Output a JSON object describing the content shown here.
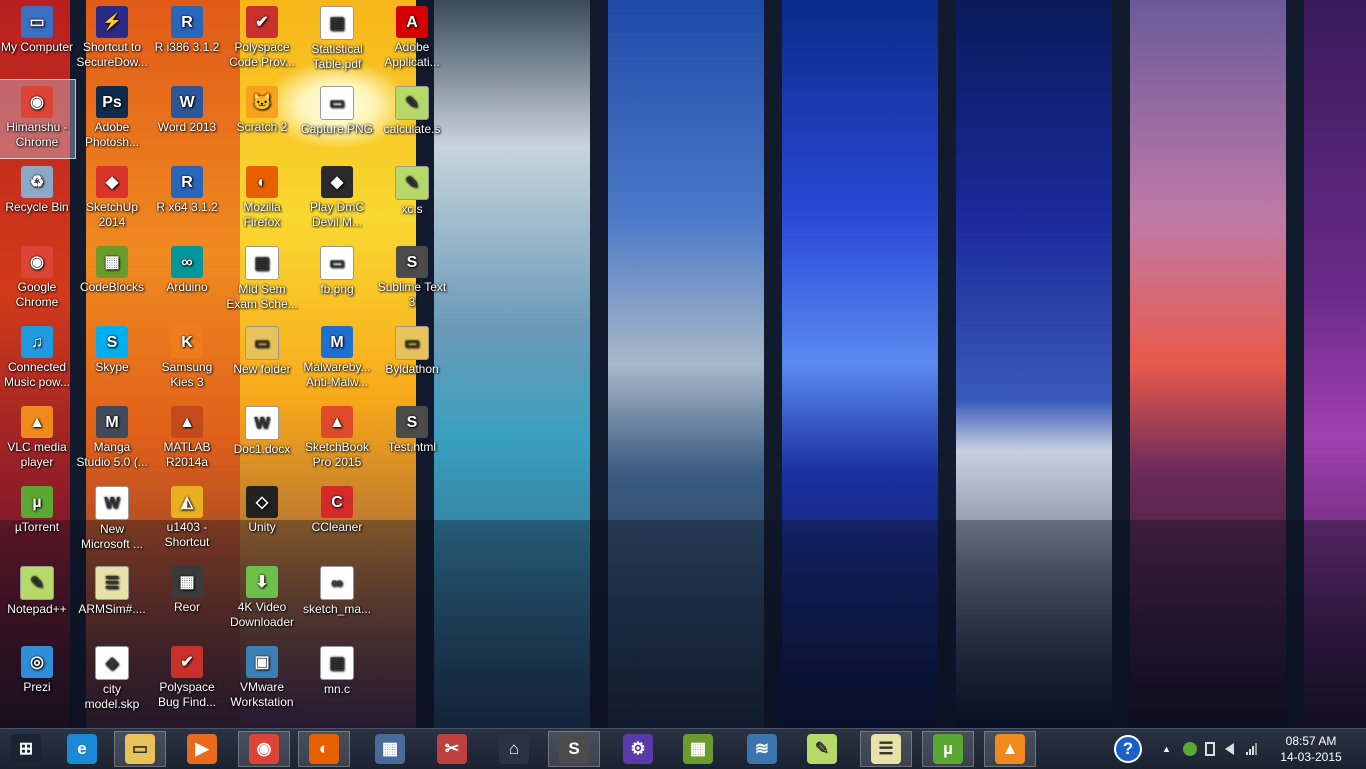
{
  "desktop": {
    "icons": [
      {
        "label": "My Computer",
        "icon": "computer-icon",
        "color": "#3a6fc4",
        "glyph": "▭"
      },
      {
        "label": "Himanshu - Chrome",
        "icon": "chrome-icon",
        "color": "#db4437",
        "glyph": "◉",
        "selected": true
      },
      {
        "label": "Recycle Bin",
        "icon": "recycle-bin-icon",
        "color": "#8aa9c6",
        "glyph": "♻"
      },
      {
        "label": "Google Chrome",
        "icon": "chrome-icon",
        "color": "#db4437",
        "glyph": "◉"
      },
      {
        "label": "Connected Music pow...",
        "icon": "music-icon",
        "color": "#1e9be0",
        "glyph": "♫"
      },
      {
        "label": "VLC media player",
        "icon": "vlc-icon",
        "color": "#f08a1c",
        "glyph": "▲"
      },
      {
        "label": "µTorrent",
        "icon": "utorrent-icon",
        "color": "#5aa832",
        "glyph": "µ"
      },
      {
        "label": "Notepad++",
        "icon": "notepad-plus-icon",
        "color": "#b7d96a",
        "glyph": "✎"
      },
      {
        "label": "Prezi",
        "icon": "prezi-icon",
        "color": "#2f8ed8",
        "glyph": "◎"
      },
      {
        "label": "Shortcut to SecureDow...",
        "icon": "lightning-icon",
        "color": "#2a2a8a",
        "glyph": "⚡"
      },
      {
        "label": "Adobe Photosh...",
        "icon": "photoshop-icon",
        "color": "#0f2a4a",
        "glyph": "Ps"
      },
      {
        "label": "SketchUp 2014",
        "icon": "sketchup-icon",
        "color": "#d9342b",
        "glyph": "◆"
      },
      {
        "label": "CodeBlocks",
        "icon": "codeblocks-icon",
        "color": "#6b9b2c",
        "glyph": "▦"
      },
      {
        "label": "Skype",
        "icon": "skype-icon",
        "color": "#00aff0",
        "glyph": "S"
      },
      {
        "label": "Manga Studio 5.0 (...",
        "icon": "manga-studio-icon",
        "color": "#404a5a",
        "glyph": "M"
      },
      {
        "label": "New Microsoft ...",
        "icon": "word-doc-icon",
        "color": "#ffffff",
        "glyph": "W"
      },
      {
        "label": "ARMSim#....",
        "icon": "armsim-icon",
        "color": "#e8e2a8",
        "glyph": "☰"
      },
      {
        "label": "city model.skp",
        "icon": "sketchup-file-icon",
        "color": "#ffffff",
        "glyph": "◆"
      },
      {
        "label": "R i386 3.1.2",
        "icon": "r-icon",
        "color": "#2766b8",
        "glyph": "R"
      },
      {
        "label": "Word 2013",
        "icon": "word-icon",
        "color": "#2b579a",
        "glyph": "W"
      },
      {
        "label": "R x64 3.1.2",
        "icon": "r-icon",
        "color": "#2766b8",
        "glyph": "R"
      },
      {
        "label": "Arduino",
        "icon": "arduino-icon",
        "color": "#00979c",
        "glyph": "∞"
      },
      {
        "label": "Samsung Kies 3",
        "icon": "samsung-kies-icon",
        "color": "#f07b1d",
        "glyph": "K"
      },
      {
        "label": "MATLAB R2014a",
        "icon": "matlab-icon",
        "color": "#c44a1e",
        "glyph": "▲"
      },
      {
        "label": "u1403 - Shortcut",
        "icon": "u1403-icon",
        "color": "#e8b020",
        "glyph": "◭"
      },
      {
        "label": "Reor",
        "icon": "reor-icon",
        "color": "#3a3a3a",
        "glyph": "▦"
      },
      {
        "label": "Polyspace Bug Find...",
        "icon": "polyspace-icon",
        "color": "#c9302c",
        "glyph": "✔"
      },
      {
        "label": "Polyspace Code Prov...",
        "icon": "polyspace-icon",
        "color": "#c9302c",
        "glyph": "✔"
      },
      {
        "label": "Scratch 2",
        "icon": "scratch-icon",
        "color": "#f7a21a",
        "glyph": "🐱"
      },
      {
        "label": "Mozilla Firefox",
        "icon": "firefox-icon",
        "color": "#e66000",
        "glyph": "◐"
      },
      {
        "label": "Mid Sem Exam Sche...",
        "icon": "pdf-file-icon",
        "color": "#ffffff",
        "glyph": "▤"
      },
      {
        "label": "New folder",
        "icon": "folder-icon",
        "color": "#e8c25a",
        "glyph": "▭"
      },
      {
        "label": "Doc1.docx",
        "icon": "word-doc-icon",
        "color": "#ffffff",
        "glyph": "W"
      },
      {
        "label": "Unity",
        "icon": "unity-icon",
        "color": "#222222",
        "glyph": "◇"
      },
      {
        "label": "4K Video Downloader",
        "icon": "video-downloader-icon",
        "color": "#6cbf4a",
        "glyph": "⬇"
      },
      {
        "label": "VMware Workstation",
        "icon": "vmware-icon",
        "color": "#3c7fb5",
        "glyph": "▣"
      },
      {
        "label": "Statistical Table.pdf",
        "icon": "pdf-file-icon",
        "color": "#ffffff",
        "glyph": "▤"
      },
      {
        "label": "Capture.PNG",
        "icon": "image-file-icon",
        "color": "#ffffff",
        "glyph": "▭"
      },
      {
        "label": "Play DmC Devil M...",
        "icon": "game-icon",
        "color": "#2a2a2a",
        "glyph": "◆"
      },
      {
        "label": "fb.png",
        "icon": "image-file-icon",
        "color": "#ffffff",
        "glyph": "▭"
      },
      {
        "label": "Malwareby... Anti-Malw...",
        "icon": "malwarebytes-icon",
        "color": "#1f6fd1",
        "glyph": "M"
      },
      {
        "label": "SketchBook Pro 2015",
        "icon": "sketchbook-icon",
        "color": "#e04a2c",
        "glyph": "▲"
      },
      {
        "label": "CCleaner",
        "icon": "ccleaner-icon",
        "color": "#d42a2a",
        "glyph": "C"
      },
      {
        "label": "sketch_ma...",
        "icon": "arduino-file-icon",
        "color": "#ffffff",
        "glyph": "∞"
      },
      {
        "label": "mn.c",
        "icon": "c-file-icon",
        "color": "#ffffff",
        "glyph": "▤"
      },
      {
        "label": "Adobe Applicati...",
        "icon": "adobe-icon",
        "color": "#d40000",
        "glyph": "A"
      },
      {
        "label": "calculate.s",
        "icon": "notepad-plus-file-icon",
        "color": "#b7d96a",
        "glyph": "✎"
      },
      {
        "label": "xc.s",
        "icon": "notepad-plus-file-icon",
        "color": "#b7d96a",
        "glyph": "✎"
      },
      {
        "label": "Sublime Text 3",
        "icon": "sublime-icon",
        "color": "#4b4b4b",
        "glyph": "S"
      },
      {
        "label": "Byldathon",
        "icon": "folder-icon",
        "color": "#e8c25a",
        "glyph": "▭"
      },
      {
        "label": "Test.html",
        "icon": "sublime-file-icon",
        "color": "#4b4b4b",
        "glyph": "S"
      }
    ]
  },
  "taskbar": {
    "buttons": [
      {
        "name": "start-button",
        "icon": "windows-logo-icon",
        "color": "#1a2433",
        "glyph": "⊞"
      },
      {
        "name": "ie-button",
        "icon": "internet-explorer-icon",
        "color": "#1a8ad6",
        "glyph": "e"
      },
      {
        "name": "file-explorer-button",
        "icon": "folder-icon",
        "color": "#e8c25a",
        "glyph": "▭",
        "active": true
      },
      {
        "name": "media-player-button",
        "icon": "media-player-icon",
        "color": "#e86a1c",
        "glyph": "▶"
      },
      {
        "name": "chrome-button",
        "icon": "chrome-icon",
        "color": "#db4437",
        "glyph": "◉",
        "active": true
      },
      {
        "name": "firefox-button",
        "icon": "firefox-icon",
        "color": "#e66000",
        "glyph": "◐",
        "active": true
      },
      {
        "name": "calculator-button",
        "icon": "calculator-icon",
        "color": "#4a6a9a",
        "glyph": "▦"
      },
      {
        "name": "snipping-tool-button",
        "icon": "scissors-icon",
        "color": "#c04040",
        "glyph": "✂"
      },
      {
        "name": "home-button",
        "icon": "home-icon",
        "color": "#2a3344",
        "glyph": "⌂"
      },
      {
        "name": "sublime-button",
        "icon": "sublime-icon",
        "color": "#4b4b4b",
        "glyph": "S",
        "active": true
      },
      {
        "name": "settings-button",
        "icon": "gear-icon",
        "color": "#5a3aa8",
        "glyph": "⚙"
      },
      {
        "name": "codeblocks-button",
        "icon": "codeblocks-icon",
        "color": "#6b9b2c",
        "glyph": "▦"
      },
      {
        "name": "python-button",
        "icon": "python-icon",
        "color": "#3a75b0",
        "glyph": "≋"
      },
      {
        "name": "notepad-plus-button",
        "icon": "notepad-plus-icon",
        "color": "#b7d96a",
        "glyph": "✎"
      },
      {
        "name": "armsim-button",
        "icon": "armsim-icon",
        "color": "#e8e2a8",
        "glyph": "☰",
        "active": true
      },
      {
        "name": "utorrent-button",
        "icon": "utorrent-icon",
        "color": "#5aa832",
        "glyph": "µ",
        "active": true
      },
      {
        "name": "vlc-button",
        "icon": "vlc-icon",
        "color": "#f08a1c",
        "glyph": "▲",
        "active": true
      }
    ],
    "tray": {
      "help_glyph": "?",
      "chevron_glyph": "▲"
    },
    "clock": {
      "time": "08:57 AM",
      "date": "14-03-2015"
    }
  }
}
